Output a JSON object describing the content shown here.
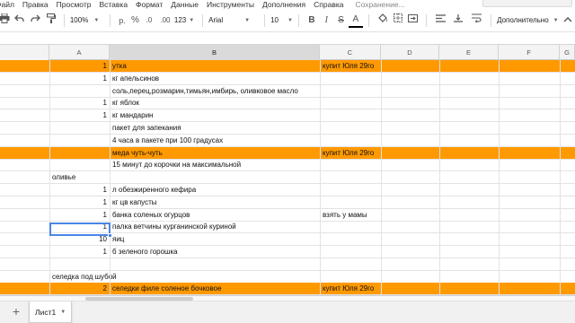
{
  "menu": {
    "items": [
      "Файл",
      "Правка",
      "Просмотр",
      "Вставка",
      "Формат",
      "Данные",
      "Инструменты",
      "Дополнения",
      "Справка"
    ],
    "saving_status": "Сохранение..."
  },
  "toolbar": {
    "zoom": "100%",
    "currency": "р.",
    "percent": "%",
    "dec_decrease": ".0",
    "dec_increase": ".00",
    "more_formats": "123",
    "font": "Arial",
    "font_size": "10",
    "bold": "B",
    "italic": "I",
    "strike": "S",
    "text_color": "A",
    "more": "Дополнительно"
  },
  "columns": [
    "A",
    "B",
    "C",
    "D",
    "E",
    "F",
    "G"
  ],
  "rows": [
    {
      "b": "1",
      "c": "утка",
      "d": "купит Юля 29го",
      "hl": true
    },
    {
      "b": "1",
      "c": "кг апельсинов",
      "d": ""
    },
    {
      "b": "",
      "c": "соль,перец,розмарин,тимьян,имбирь, оливковое масло",
      "d": ""
    },
    {
      "b": "1",
      "c": "кг яблок",
      "d": ""
    },
    {
      "b": "1",
      "c": "кг мандарин",
      "d": ""
    },
    {
      "b": "",
      "c": "пакет для запекания",
      "d": ""
    },
    {
      "b": "",
      "c": "4 часа в пакете при 100 градусах",
      "d": ""
    },
    {
      "b": "",
      "c": "меда чуть-чуть",
      "d": "купит Юля 29го",
      "hl": true
    },
    {
      "b": "",
      "c": "15 минут до корочки на максимальной",
      "d": ""
    },
    {
      "a": "оливье",
      "b": "",
      "c": "",
      "d": ""
    },
    {
      "b": "1",
      "c": "л обезжиренного кефира",
      "d": ""
    },
    {
      "b": "1",
      "c": "кг цв капусты",
      "d": ""
    },
    {
      "b": "1",
      "c": "банка соленых огурцов",
      "d": "взять у мамы"
    },
    {
      "b": "1",
      "c": "палка ветчины курганинской куриной",
      "d": ""
    },
    {
      "b": "10",
      "c": "яиц",
      "d": ""
    },
    {
      "b": "1",
      "c": "б зеленого горошка",
      "d": ""
    },
    {
      "b": "",
      "c": "",
      "d": ""
    },
    {
      "a": "селедка под шубой",
      "b": "",
      "c": "",
      "d": ""
    },
    {
      "b": "2",
      "c": "селедки филе соленое бочковое",
      "d": "купит Юля 29го",
      "hl": true
    }
  ],
  "sheet": {
    "name": "Лист1"
  },
  "colors": {
    "highlight": "#ff9900",
    "selection": "#4a86e8"
  }
}
